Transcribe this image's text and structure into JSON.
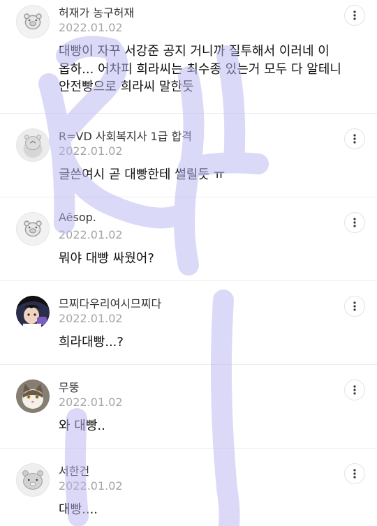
{
  "comments": [
    {
      "avatar": "bear-pig-avatar",
      "author": "허재가 농구허재",
      "date": "2022.01.02",
      "text": "대빵이 자꾸 서강준 공지 거니까 질투해서 이러네 이\n옵하... 어차피 희라씨는 최수종 있는거 모두 다 알테니\n안전빵으로 희라씨 말한듯"
    },
    {
      "avatar": "blue-animal-avatar",
      "author": "R=VD 사회복지사 1급 합격",
      "date": "2022.01.02",
      "text": "글쓴여시 곧 대빵한테 썰릴듯 ㅠ"
    },
    {
      "avatar": "bear-pig-avatar",
      "author": "Aēsop.",
      "date": "2022.01.02",
      "text": "뭐야 대빵 싸웠어?"
    },
    {
      "avatar": "anime-character-avatar",
      "author": "므찌다우리여시므찌다",
      "date": "2022.01.02",
      "text": "희라대빵...?"
    },
    {
      "avatar": "cat-photo-avatar",
      "author": "무뚱",
      "date": "2022.01.02",
      "text": "와 대빵.."
    },
    {
      "avatar": "gray-bear-avatar",
      "author": "서한건",
      "date": "2022.01.02",
      "text": "대빵...."
    }
  ],
  "more_icon": "vertical-dots-icon",
  "watermark_color": "#b9b4f2"
}
